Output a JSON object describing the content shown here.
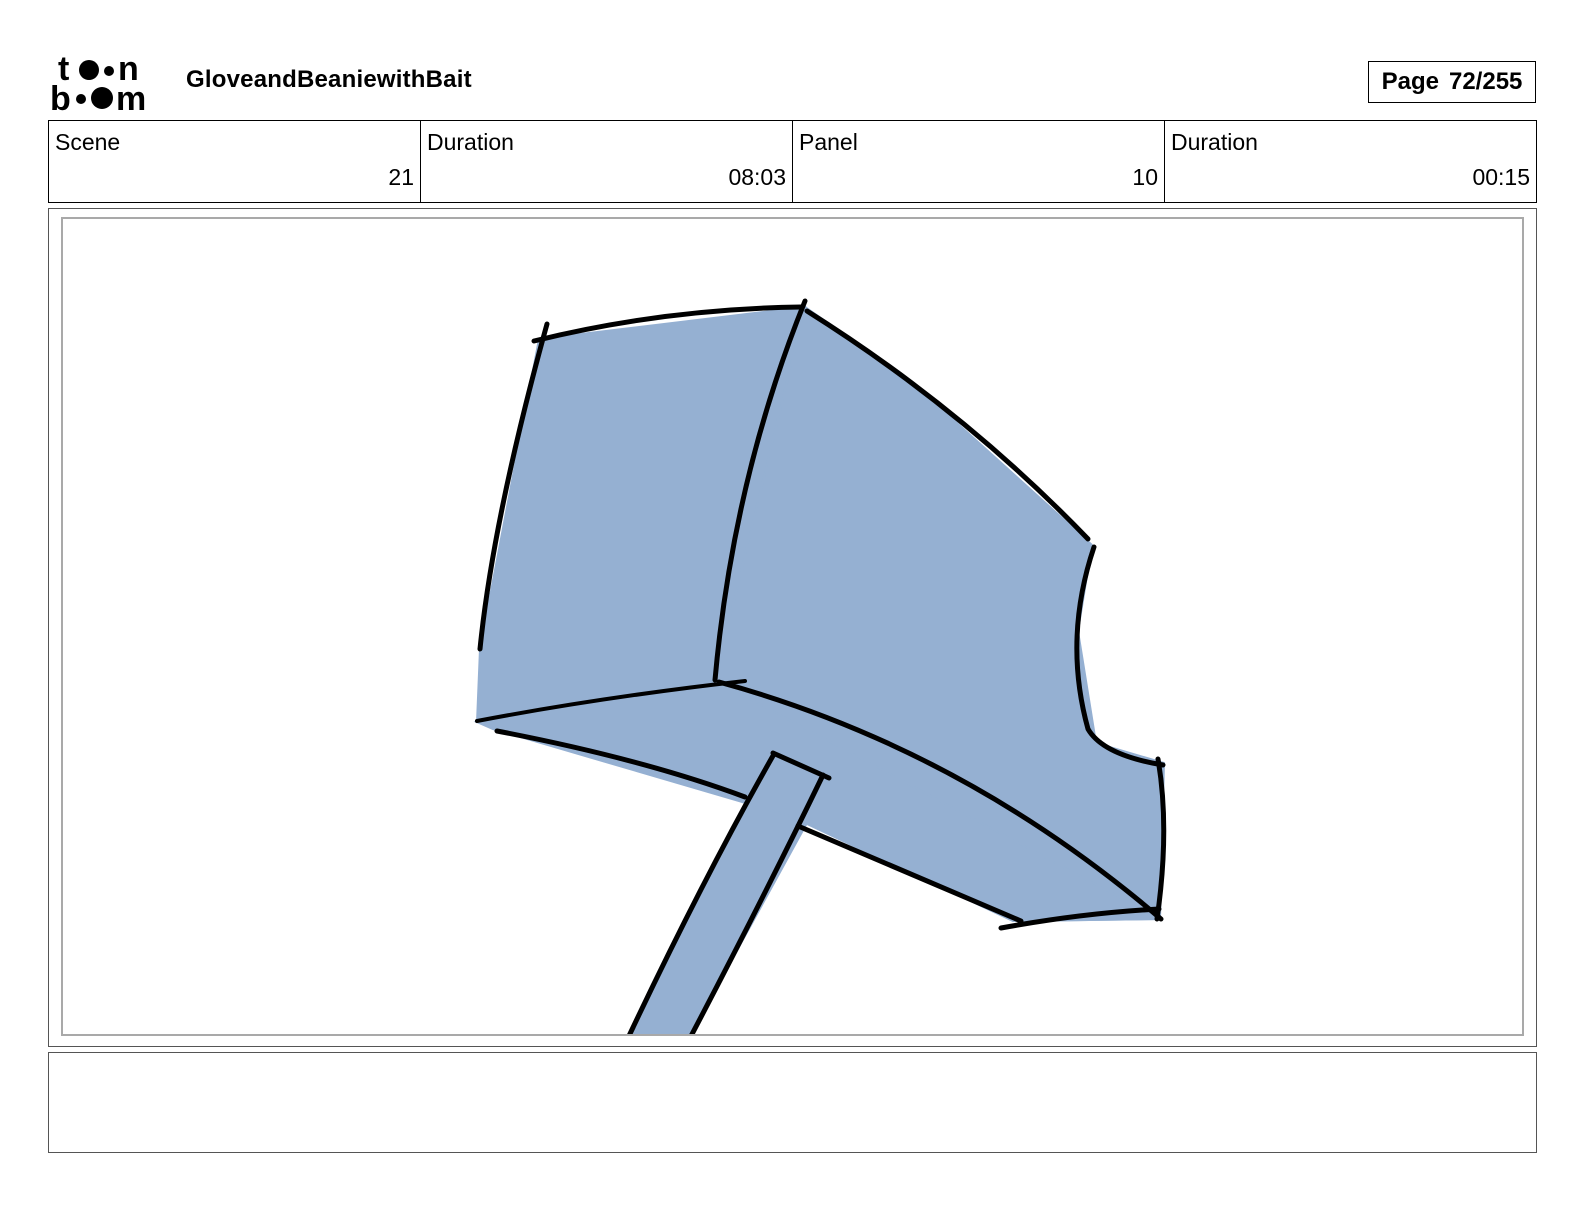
{
  "header": {
    "logo_text": "toon boom",
    "project_title": "GloveandBeaniewithBait",
    "page_label": "Page",
    "page_number": "72/255"
  },
  "info": {
    "scene_label": "Scene",
    "scene_value": "21",
    "scene_duration_label": "Duration",
    "scene_duration_value": "08:03",
    "panel_label": "Panel",
    "panel_value": "10",
    "panel_duration_label": "Duration",
    "panel_duration_value": "00:15"
  },
  "drawing": {
    "subject": "hammer-drawing",
    "fill_color": "#95b0d2",
    "stroke_color": "#000000"
  },
  "notes": {
    "text": ""
  }
}
